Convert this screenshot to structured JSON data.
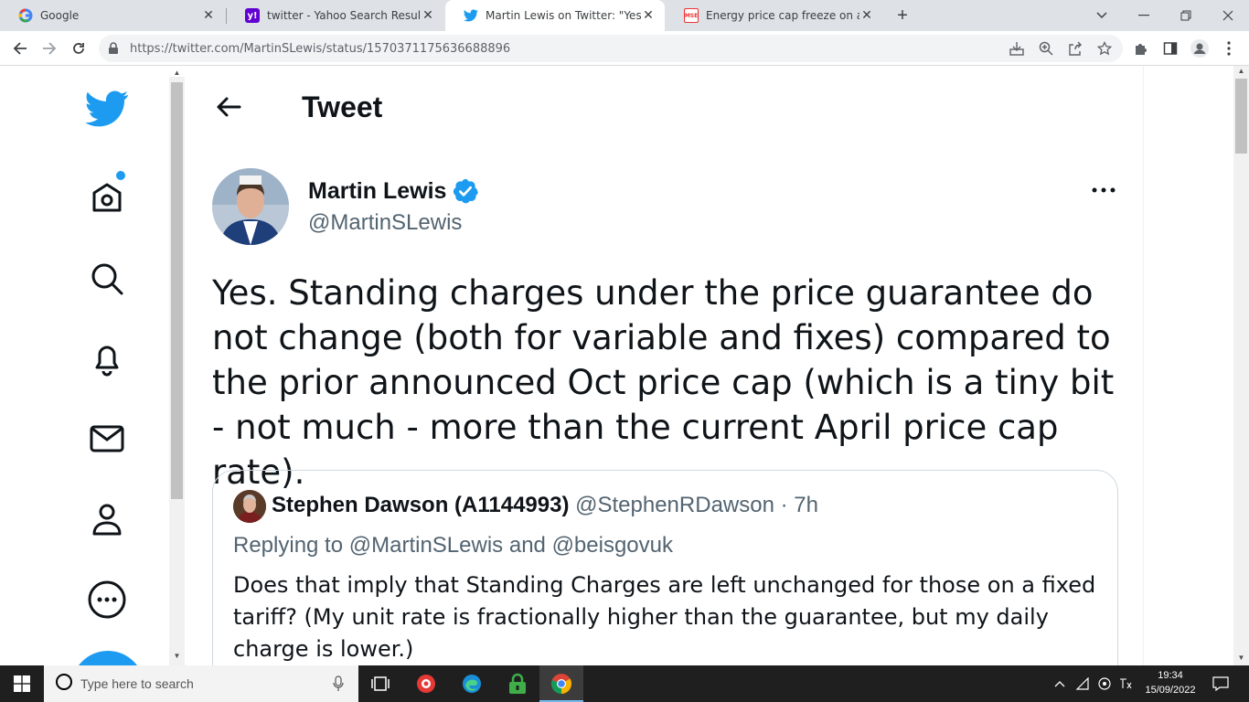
{
  "browser": {
    "tabs": [
      {
        "title": "Google",
        "icon": "google-icon",
        "active": false
      },
      {
        "title": "twitter - Yahoo Search Results",
        "icon": "yahoo-icon",
        "active": false
      },
      {
        "title": "Martin Lewis on Twitter: \"Yes. Sta",
        "icon": "twitter-icon",
        "active": true
      },
      {
        "title": "Energy price cap freeze on a fixed",
        "icon": "mse-icon",
        "active": false
      }
    ],
    "url": "https://twitter.com/MartinSLewis/status/1570371175636688896"
  },
  "twitter": {
    "header_title": "Tweet",
    "author_name": "Martin Lewis",
    "author_handle": "@MartinSLewis",
    "tweet_text": "Yes.  Standing charges under the price guarantee do not change (both for variable and fixes) compared to the prior announced Oct price cap (which is a tiny bit - not much - more than the current April price cap rate).",
    "quote": {
      "name": "Stephen Dawson (A1144993)",
      "meta": "@StephenRDawson · 7h",
      "reply_prefix": "Replying to",
      "reply_to_1": "@MartinSLewis",
      "reply_and": "and",
      "reply_to_2": "@beisgovuk",
      "text": "Does that imply that Standing Charges are left unchanged for those on a fixed tariff? (My unit rate is fractionally higher than the guarantee, but my daily charge is lower.)"
    },
    "colors": {
      "brand": "#1d9bf0",
      "text": "#0f1419",
      "muted": "#536471"
    }
  },
  "taskbar": {
    "search_placeholder": "Type here to search",
    "time": "19:34",
    "date": "15/09/2022"
  }
}
